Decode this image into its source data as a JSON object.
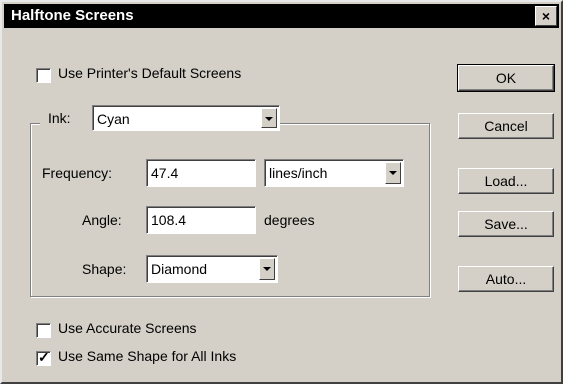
{
  "window": {
    "title": "Halftone Screens",
    "close_glyph": "×"
  },
  "options": {
    "use_printer_default": {
      "label": "Use Printer's Default Screens",
      "checked": false
    },
    "use_accurate": {
      "label": "Use Accurate Screens",
      "checked": false
    },
    "use_same_shape": {
      "label": "Use Same Shape for All Inks",
      "checked": true
    }
  },
  "ink": {
    "label": "Ink:",
    "value": "Cyan"
  },
  "frequency": {
    "label": "Frequency:",
    "value": "47.4",
    "unit": "lines/inch"
  },
  "angle": {
    "label": "Angle:",
    "value": "108.4",
    "unit": "degrees"
  },
  "shape": {
    "label": "Shape:",
    "value": "Diamond"
  },
  "buttons": {
    "ok": "OK",
    "cancel": "Cancel",
    "load": "Load...",
    "save": "Save...",
    "auto": "Auto..."
  },
  "colors": {
    "titlebar": "#000000",
    "dialog_bg": "#d4d0c8"
  }
}
